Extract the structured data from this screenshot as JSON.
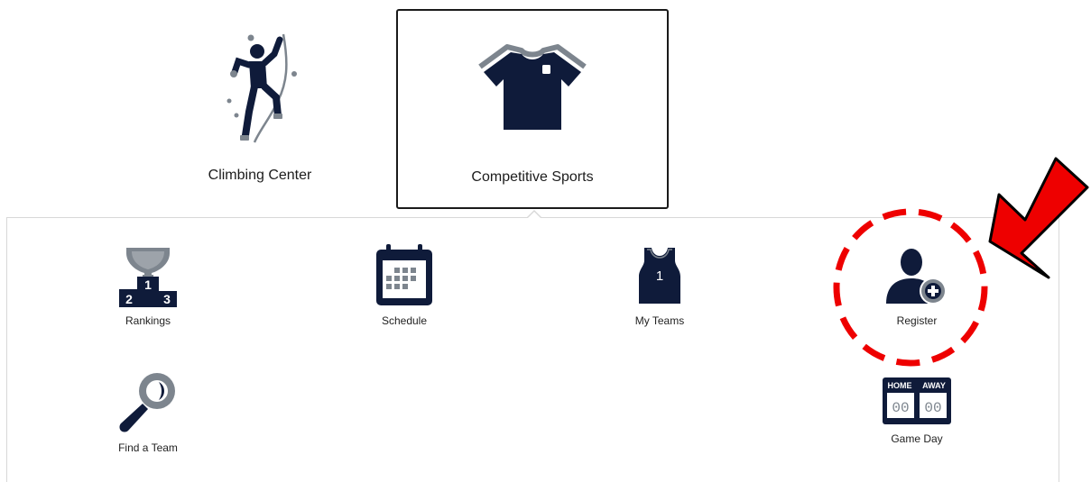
{
  "categories": [
    {
      "label": "Climbing Center",
      "icon": "climber-icon",
      "active": false
    },
    {
      "label": "Competitive Sports",
      "icon": "jersey-icon",
      "active": true
    }
  ],
  "submenu": {
    "items": [
      {
        "label": "Rankings",
        "icon": "podium-trophy-icon"
      },
      {
        "label": "Schedule",
        "icon": "calendar-icon"
      },
      {
        "label": "My Teams",
        "icon": "jersey-tank-icon",
        "jersey_number": "1"
      },
      {
        "label": "Register",
        "icon": "user-add-icon"
      },
      {
        "label": "Find a Team",
        "icon": "magnifier-icon"
      },
      {
        "label": "Game Day",
        "icon": "scoreboard-icon"
      }
    ],
    "podium": {
      "first": "1",
      "second": "2",
      "third": "3"
    },
    "scoreboard": {
      "home": "HOME",
      "away": "AWAY",
      "home_score": "00",
      "away_score": "00"
    }
  },
  "annotation": {
    "color": "#ee0000"
  },
  "colors": {
    "navy": "#0f1b3a",
    "gray": "#7d858e"
  }
}
